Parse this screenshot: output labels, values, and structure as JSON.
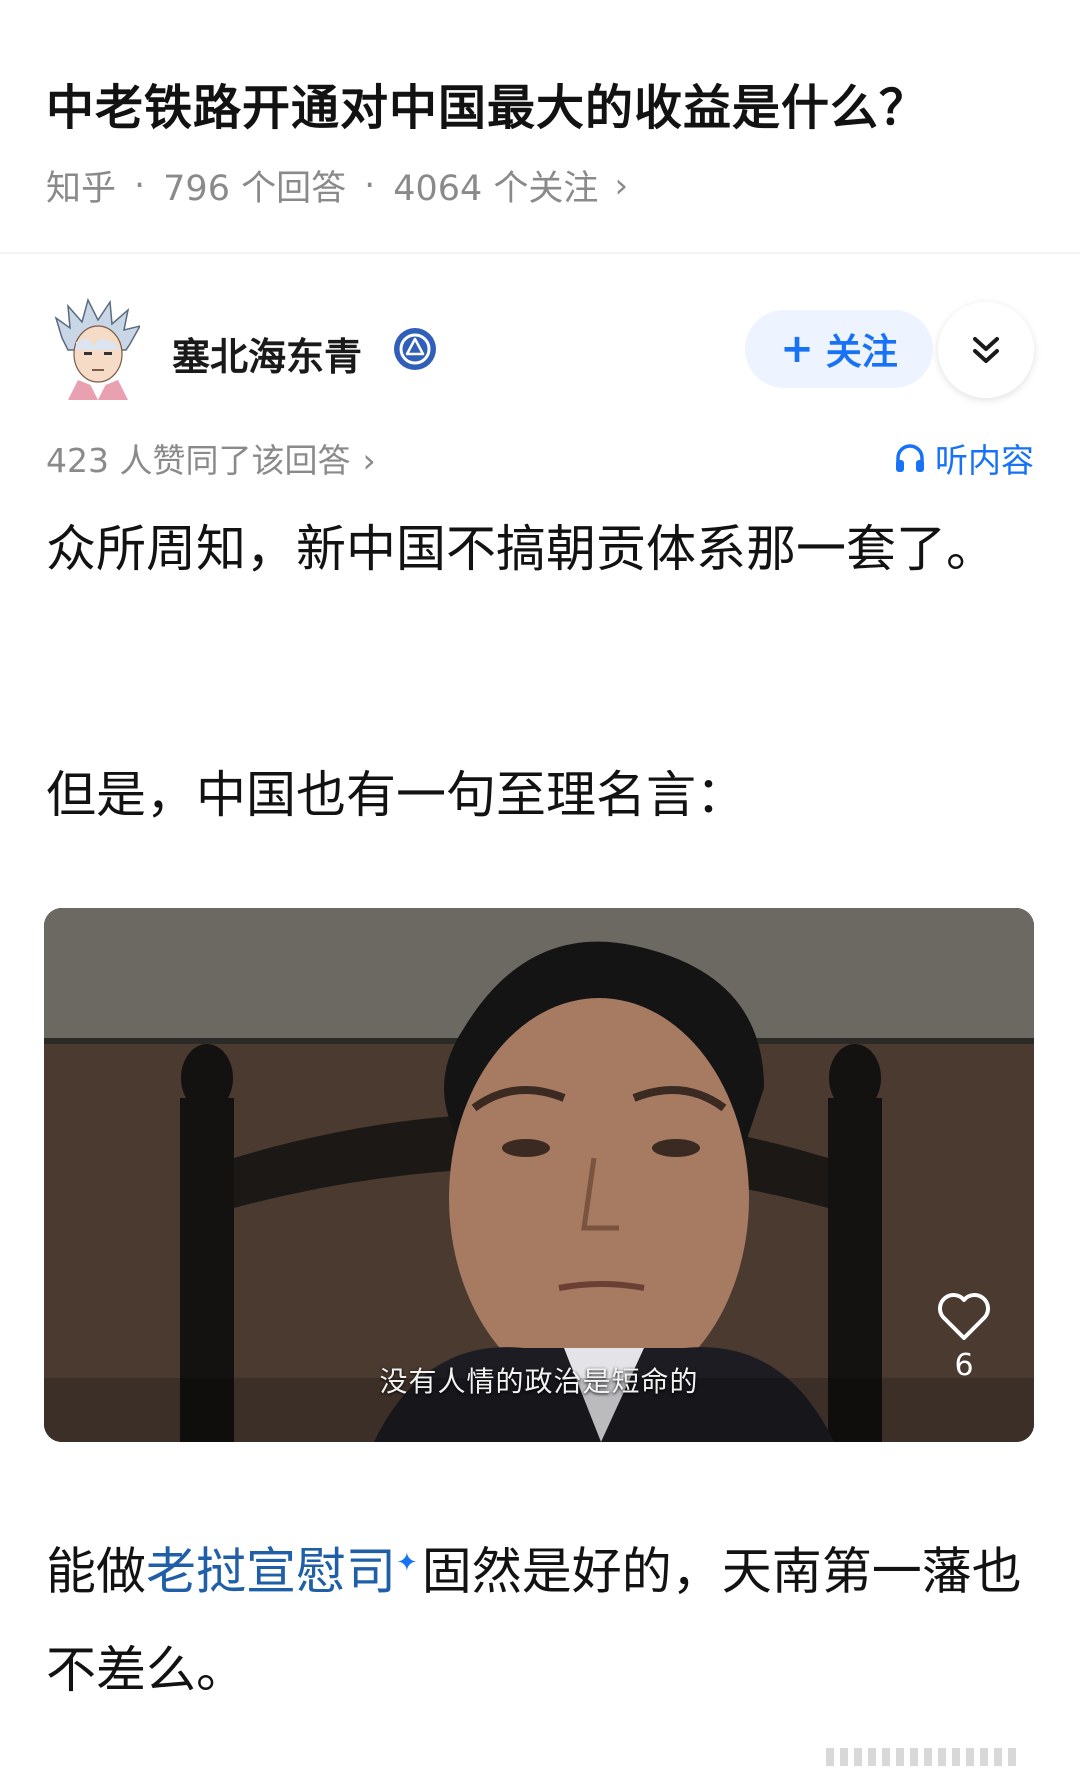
{
  "question": {
    "title": "中老铁路开通对中国最大的收益是什么？",
    "source": "知乎",
    "answers": "796 个回答",
    "followers": "4064 个关注",
    "sep": "·",
    "chevron": "›"
  },
  "author": {
    "name": "塞北海东青",
    "avatar_icon": "anime-character-avatar",
    "verified_icon": "verified-badge-icon",
    "follow_label": "关注",
    "follow_plus": "+",
    "expand_icon": "double-chevron-down-icon"
  },
  "answer_meta": {
    "likes_text": "423 人赞同了该回答",
    "chevron": "›",
    "listen_label": "听内容",
    "listen_icon": "headphones-icon"
  },
  "content": {
    "p1": "众所周知，新中国不搞朝贡体系那一套了。",
    "p2": "但是，中国也有一句至理名言：",
    "p3_link": "老挝宣慰司",
    "p3_before": "能做",
    "p3_after": "固然是好的，天南第一藩也不差么。"
  },
  "media": {
    "subtitle": "没有人情的政治是短命的",
    "like_count": "6",
    "like_icon": "heart-outline-icon"
  },
  "colors": {
    "accent": "#1772f6",
    "link": "#1f5fa8",
    "meta_gray": "#8a8a8a",
    "follow_bg": "#eef4ff"
  }
}
